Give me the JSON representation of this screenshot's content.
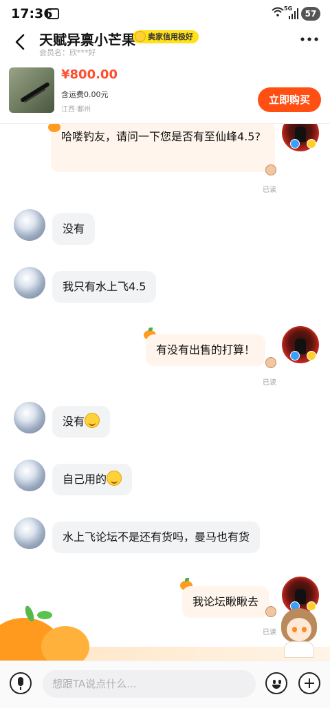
{
  "status_bar": {
    "time": "17:36",
    "network": "5G",
    "battery": "57"
  },
  "header": {
    "seller_name": "天赋异禀小芒果",
    "credit_badge": "卖家信用极好",
    "member_label": "会员名：",
    "member_name": "欣***好"
  },
  "product": {
    "price": "¥800.00",
    "shipping": "含运费0.00元",
    "location": "江西·鄱州",
    "buy_button": "立即购买"
  },
  "messages": [
    {
      "side": "me",
      "text": "哈喽钓友，请问一下您是否有至仙峰4.5?",
      "status": "已读"
    },
    {
      "side": "them",
      "text": "没有"
    },
    {
      "side": "them",
      "text": "我只有水上飞4.5"
    },
    {
      "side": "me",
      "text": "有没有出售的打算！",
      "status": "已读"
    },
    {
      "side": "them",
      "text": "没有",
      "emoji": "smile-emoji"
    },
    {
      "side": "them",
      "text": "自己用的",
      "emoji": "smile-emoji"
    },
    {
      "side": "them",
      "text": "水上飞论坛不是还有货吗，曼马也有货"
    },
    {
      "side": "me",
      "text": "我论坛瞅瞅去",
      "status": "已读"
    }
  ],
  "input": {
    "placeholder": "想跟TA说点什么..."
  },
  "icons": {
    "back": "back-arrow-icon",
    "more": "more-dots-icon",
    "mic": "mic-icon",
    "emoji": "emoji-icon",
    "plus": "plus-icon"
  },
  "colors": {
    "accent": "#ff4f12",
    "price": "#ff4f2f",
    "my_bubble": "#fff5ec",
    "their_bubble": "#f2f3f5",
    "credit_badge": "#ffe019"
  }
}
